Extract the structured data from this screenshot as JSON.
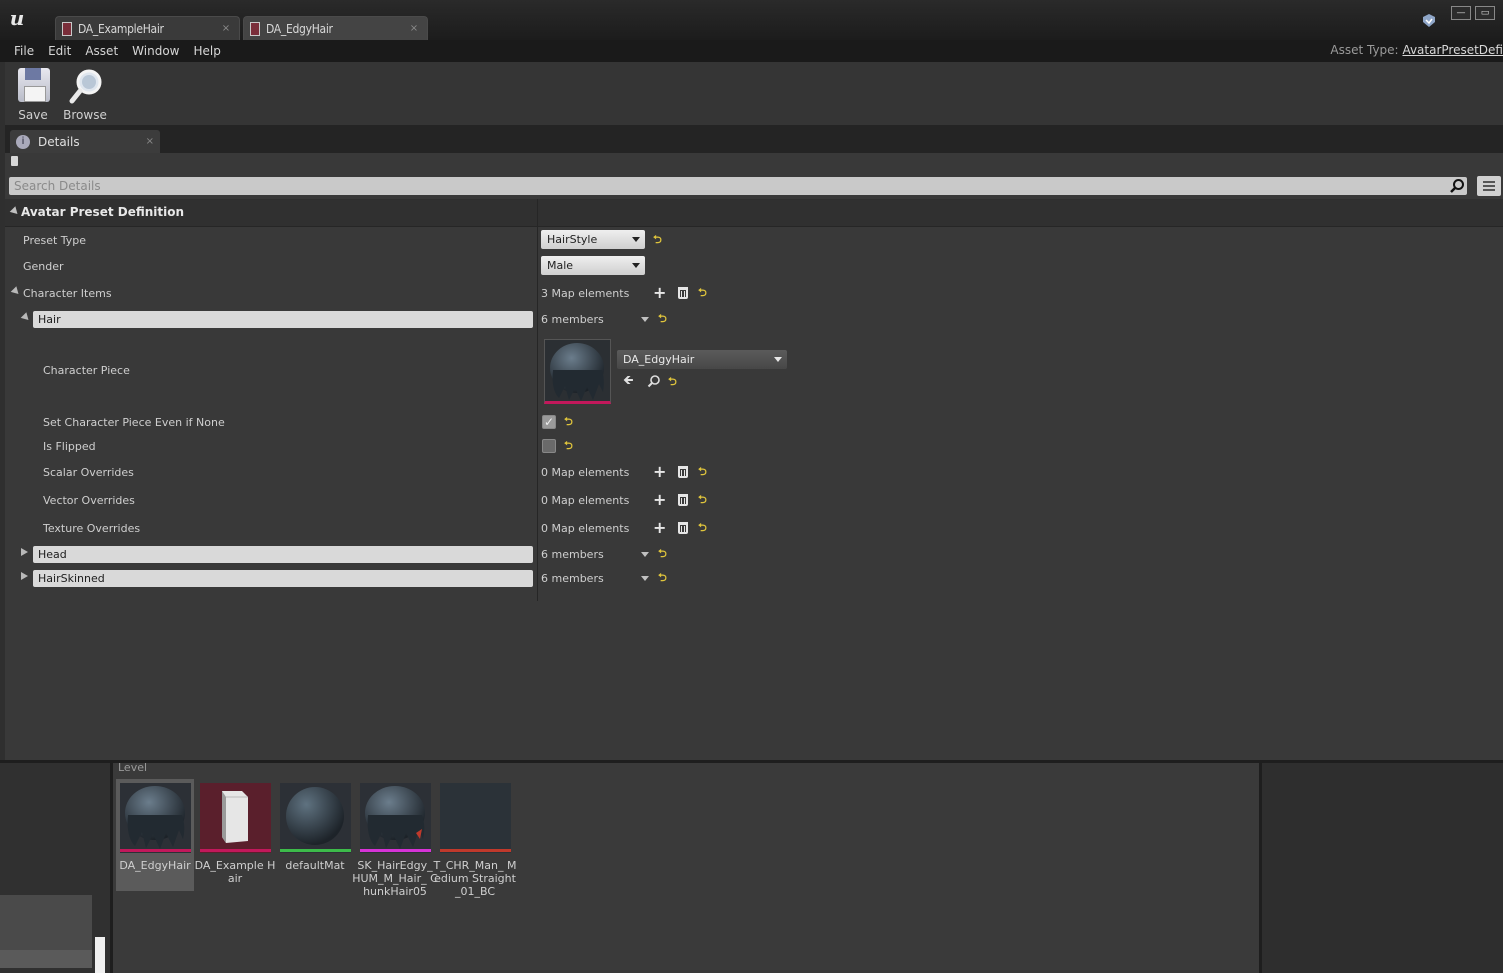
{
  "window": {
    "tabs": [
      {
        "label": "DA_ExampleHair",
        "close": "×"
      },
      {
        "label": "DA_EdgyHair",
        "close": "×"
      }
    ],
    "minimize": "—",
    "maximize": "▭"
  },
  "menu": {
    "items": [
      "File",
      "Edit",
      "Asset",
      "Window",
      "Help"
    ],
    "asset_type_label": "Asset Type:",
    "asset_type_value": "AvatarPresetDefi"
  },
  "toolbar": {
    "save_label": "Save",
    "browse_label": "Browse"
  },
  "details": {
    "tab_label": "Details",
    "tab_close": "×",
    "search_placeholder": "Search Details",
    "category": "Avatar Preset Definition",
    "preset_type": {
      "label": "Preset Type",
      "value": "HairStyle"
    },
    "gender": {
      "label": "Gender",
      "value": "Male"
    },
    "character_items": {
      "label": "Character Items",
      "value": "3 Map elements"
    },
    "hair": {
      "key": "Hair",
      "value": "6 members",
      "character_piece": {
        "label": "Character Piece",
        "asset": "DA_EdgyHair"
      },
      "set_even_if_none": {
        "label": "Set Character Piece Even if None",
        "checked": true,
        "check_glyph": "✓"
      },
      "is_flipped": {
        "label": "Is Flipped",
        "checked": false
      },
      "scalar_overrides": {
        "label": "Scalar Overrides",
        "value": "0 Map elements"
      },
      "vector_overrides": {
        "label": "Vector Overrides",
        "value": "0 Map elements"
      },
      "texture_overrides": {
        "label": "Texture Overrides",
        "value": "0 Map elements"
      }
    },
    "head": {
      "key": "Head",
      "value": "6 members"
    },
    "hair_skinned": {
      "key": "HairSkinned",
      "value": "6 members"
    }
  },
  "content_browser": {
    "crumb": "Level",
    "assets": [
      {
        "label": "DA_EdgyHair",
        "bar_color": "#c2185b",
        "icon": "hair-icon"
      },
      {
        "label": "DA_Example Hair",
        "bar_color": "#c2185b",
        "icon": "data-asset-icon"
      },
      {
        "label": "defaultMat",
        "bar_color": "#3dbb4a",
        "icon": "sphere-icon"
      },
      {
        "label": "SK_HairEdgy_ HUM_M_Hair_ ChunkHair05",
        "bar_color": "#d633d6",
        "icon": "hair-icon"
      },
      {
        "label": "T_CHR_Man_ Medium Straight_01_BC",
        "bar_color": "#c0392b",
        "icon": "texture-icon"
      }
    ]
  },
  "colors": {
    "accent_reset": "#e0c53c",
    "data_asset": "#c2185b"
  },
  "icons": {
    "reset": "⮌",
    "add": "+",
    "use_selected": "🡸",
    "app_logo": "u"
  }
}
